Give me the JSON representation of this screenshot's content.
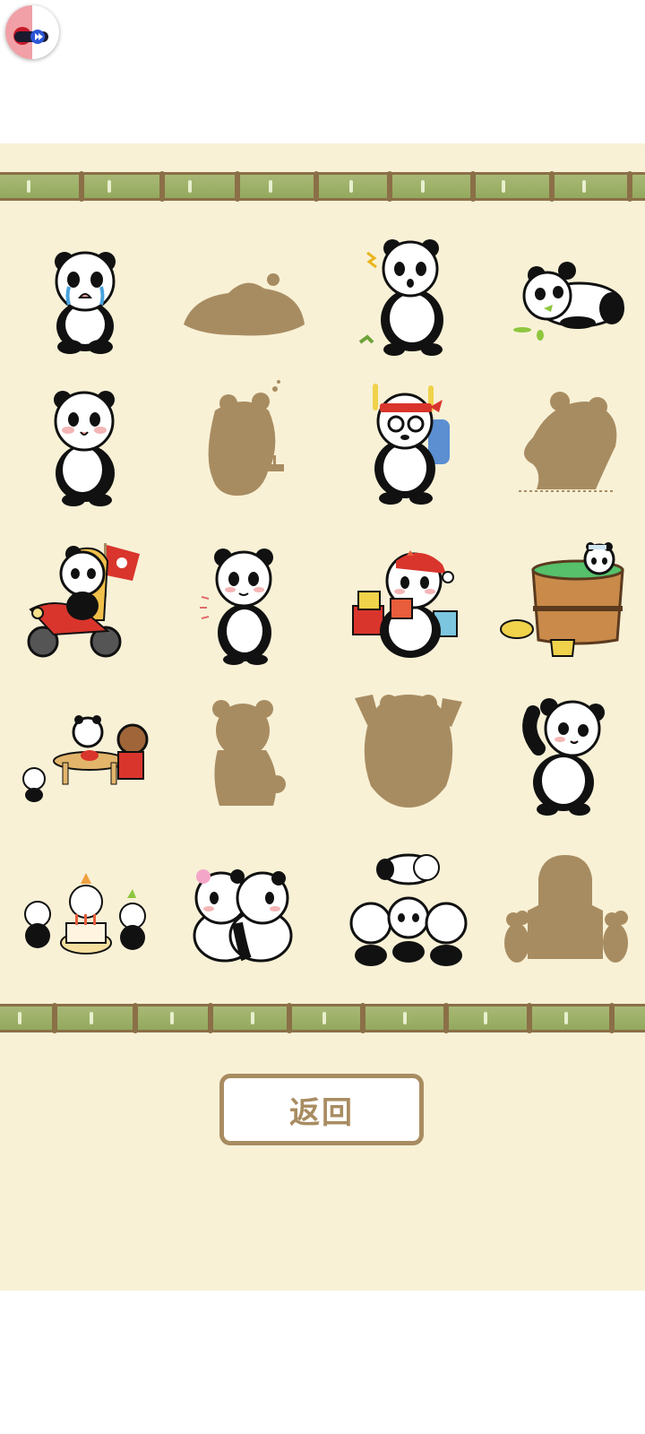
{
  "overlay": {
    "icon": "record-icon"
  },
  "collection": {
    "items": [
      {
        "state": "unlocked",
        "icon": "crying-panda-icon"
      },
      {
        "state": "locked",
        "icon": "silhouette-icon"
      },
      {
        "state": "unlocked",
        "icon": "startled-panda-icon"
      },
      {
        "state": "unlocked",
        "icon": "lying-panda-icon"
      },
      {
        "state": "unlocked",
        "icon": "blushing-panda-icon"
      },
      {
        "state": "locked",
        "icon": "silhouette-icon"
      },
      {
        "state": "unlocked",
        "icon": "backpack-panda-icon"
      },
      {
        "state": "locked",
        "icon": "silhouette-icon"
      },
      {
        "state": "unlocked",
        "icon": "motorcycle-panda-icon"
      },
      {
        "state": "unlocked",
        "icon": "shy-panda-icon"
      },
      {
        "state": "unlocked",
        "icon": "gift-panda-icon"
      },
      {
        "state": "unlocked",
        "icon": "bath-panda-icon"
      },
      {
        "state": "unlocked",
        "icon": "table-pandas-icon"
      },
      {
        "state": "locked",
        "icon": "silhouette-icon"
      },
      {
        "state": "locked",
        "icon": "silhouette-icon"
      },
      {
        "state": "unlocked",
        "icon": "waving-panda-icon"
      },
      {
        "state": "unlocked",
        "icon": "birthday-pandas-icon"
      },
      {
        "state": "unlocked",
        "icon": "hugging-pandas-icon"
      },
      {
        "state": "unlocked",
        "icon": "stacked-pandas-icon"
      },
      {
        "state": "locked",
        "icon": "silhouette-icon"
      }
    ]
  },
  "return_button": {
    "label": "返回"
  },
  "colors": {
    "panel": "#f8f1d6",
    "bamboo": "#9fb26a",
    "silhouette": "#a88c61",
    "button_border": "#a88c61"
  }
}
